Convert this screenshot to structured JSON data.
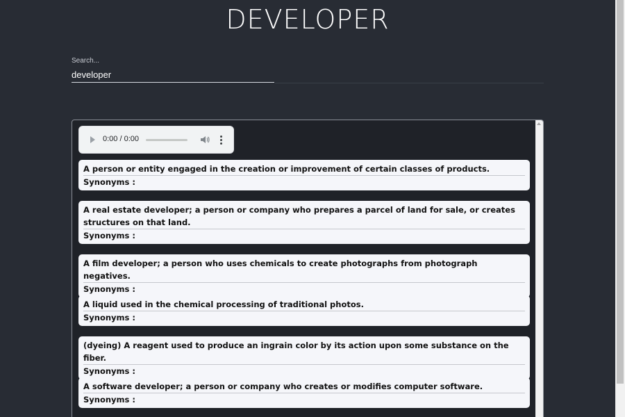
{
  "header": {
    "title": "DEVELOPER"
  },
  "search": {
    "label": "Search...",
    "value": "developer"
  },
  "audio_player": {
    "time": "0:00 / 0:00",
    "progress": 0
  },
  "definitions": [
    {
      "text": "A person or entity engaged in the creation or improvement of certain classes of products.",
      "synonyms_label": "Synonyms :"
    },
    {
      "text": "A real estate developer; a person or company who prepares a parcel of land for sale, or creates structures on that land.",
      "synonyms_label": "Synonyms :"
    },
    {
      "text": "A film developer; a person who uses chemicals to create photographs from photograph negatives.",
      "synonyms_label": "Synonyms :"
    },
    {
      "text": "A liquid used in the chemical processing of traditional photos.",
      "synonyms_label": "Synonyms :"
    },
    {
      "text": "(dyeing) A reagent used to produce an ingrain color by its action upon some substance on the fiber.",
      "synonyms_label": "Synonyms :"
    },
    {
      "text": "A software developer; a person or company who creates or modifies computer software.",
      "synonyms_label": "Synonyms :"
    }
  ],
  "colors": {
    "background": "#282c34",
    "card": "#f5f6fa",
    "text": "#111111"
  },
  "icons": [
    "play-icon",
    "volume-icon",
    "more-options-icon"
  ]
}
